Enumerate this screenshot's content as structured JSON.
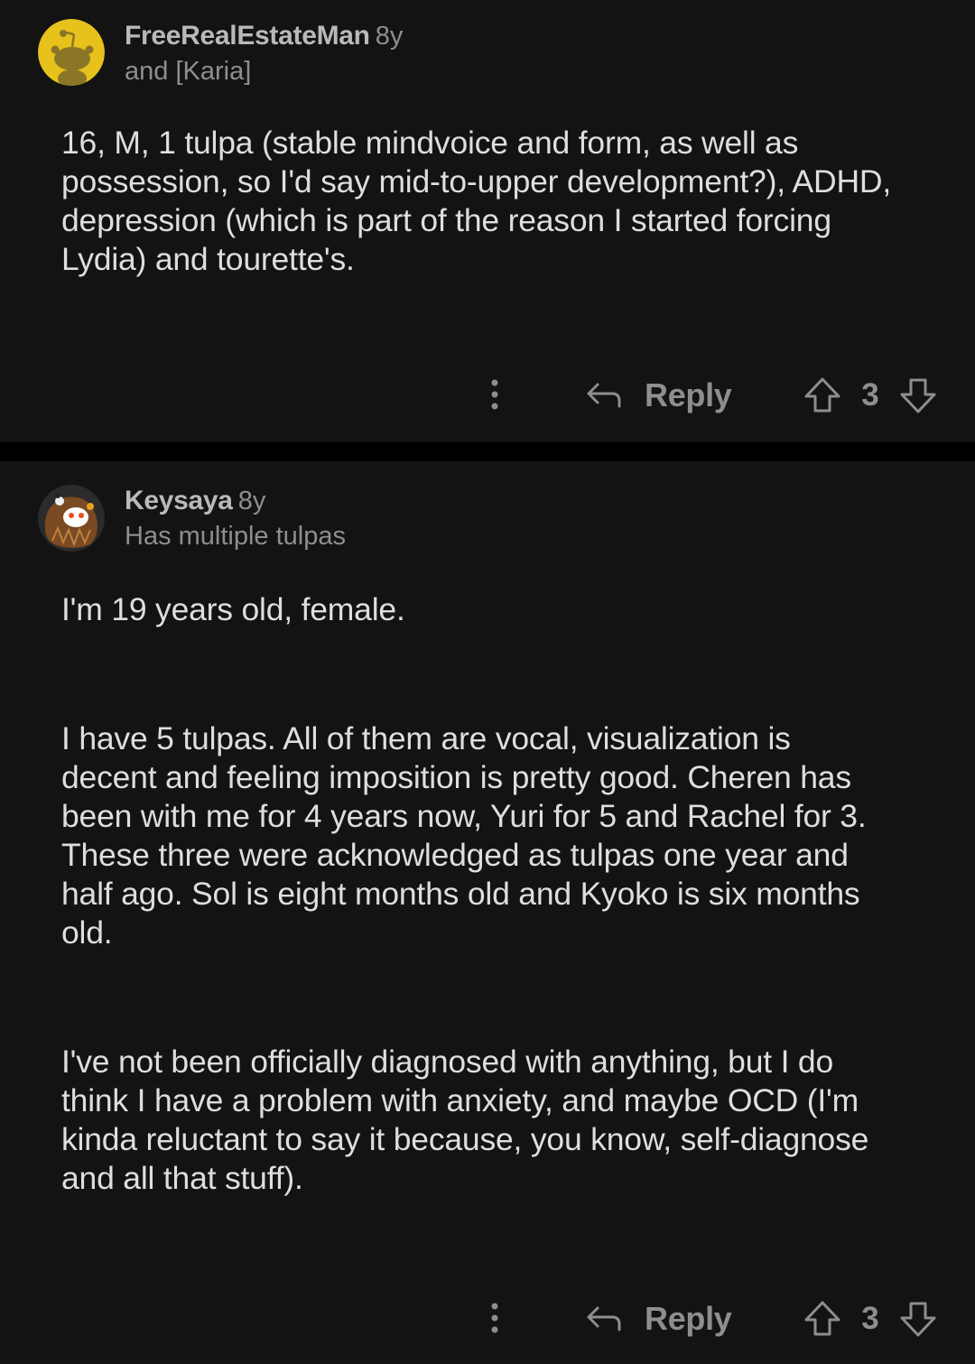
{
  "comments": [
    {
      "username": "FreeRealEstateMan",
      "age": "8y",
      "flair": "and [Karia]",
      "avatar": "snoo-avatar-yellow",
      "paragraphs": [
        "16, M, 1 tulpa (stable mindvoice and form, as well as\npossession, so I'd say mid-to-upper development?), ADHD,\ndepression (which is part of the reason I started forcing\nLydia) and tourette's."
      ],
      "reply_label": "Reply",
      "score": "3"
    },
    {
      "username": "Keysaya",
      "age": "8y",
      "flair": "Has multiple tulpas",
      "avatar": "snoo-avatar-costume",
      "paragraphs": [
        "I'm 19 years old, female.",
        "I have 5 tulpas. All of them are vocal, visualization is\ndecent and feeling imposition is pretty good. Cheren has\nbeen with me for 4 years now, Yuri for 5 and Rachel for 3.\nThese three were acknowledged as tulpas one year and\nhalf ago. Sol is eight months old and Kyoko is six months\nold.",
        "I've not been officially diagnosed with anything, but I do\nthink I have a problem with anxiety, and maybe OCD (I'm\nkinda reluctant to say it because, you know, self-diagnose\nand all that stuff)."
      ],
      "reply_label": "Reply",
      "score": "3"
    }
  ],
  "colors": {
    "background": "#000000",
    "card": "#131313",
    "text": "#dedede",
    "meta": "#8e8e8e",
    "username": "#b9b9b9"
  },
  "icons": [
    "more-options-icon",
    "reply-arrow-icon",
    "upvote-icon",
    "downvote-icon"
  ]
}
